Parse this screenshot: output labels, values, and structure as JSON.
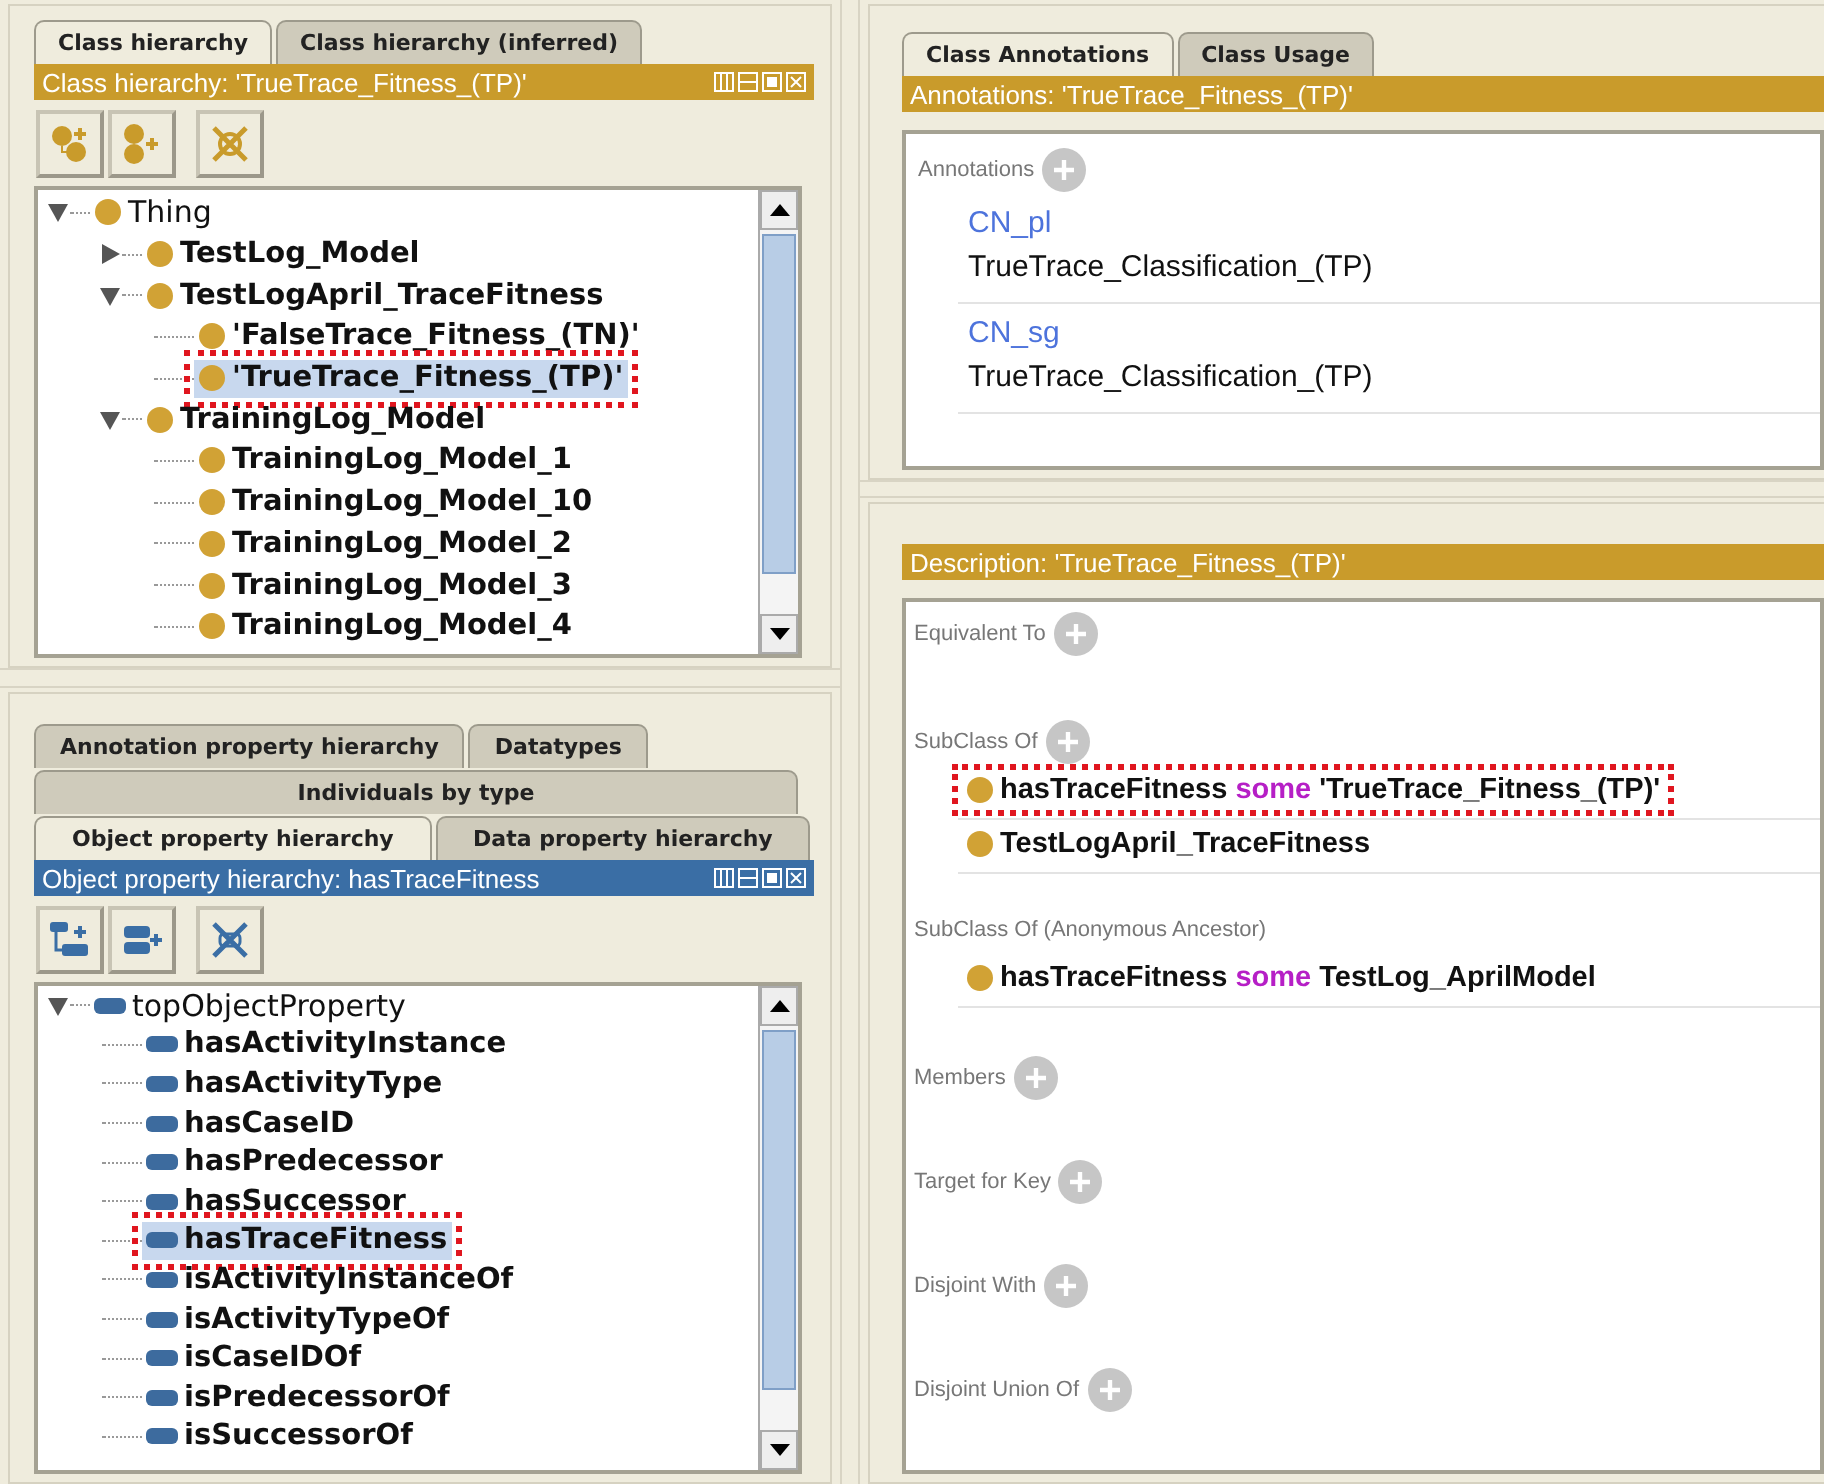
{
  "class_panel": {
    "tabs": [
      {
        "label": "Class hierarchy",
        "selected": true
      },
      {
        "label": "Class hierarchy (inferred)",
        "selected": false
      }
    ],
    "header": {
      "title": "Class hierarchy: 'TrueTrace_Fitness_(TP)'",
      "color": "#c99b2b"
    },
    "tree": {
      "items": [
        {
          "label": "Thing",
          "bold": false,
          "expanded": true,
          "selected": false,
          "highlighted": false,
          "children": [
            {
              "label": "TestLog_Model",
              "bold": true,
              "expanded": false,
              "selected": false,
              "highlighted": false
            },
            {
              "label": "TestLogApril_TraceFitness",
              "bold": true,
              "expanded": true,
              "selected": false,
              "highlighted": false,
              "children": [
                {
                  "label": "'FalseTrace_Fitness_(TN)'",
                  "bold": true,
                  "selected": false,
                  "highlighted": false
                },
                {
                  "label": "'TrueTrace_Fitness_(TP)'",
                  "bold": true,
                  "selected": true,
                  "highlighted": true
                }
              ]
            },
            {
              "label": "TrainingLog_Model",
              "bold": true,
              "expanded": true,
              "selected": false,
              "highlighted": false,
              "children": [
                {
                  "label": "TrainingLog_Model_1",
                  "bold": true,
                  "selected": false,
                  "highlighted": false
                },
                {
                  "label": "TrainingLog_Model_10",
                  "bold": true,
                  "selected": false,
                  "highlighted": false
                },
                {
                  "label": "TrainingLog_Model_2",
                  "bold": true,
                  "selected": false,
                  "highlighted": false
                },
                {
                  "label": "TrainingLog_Model_3",
                  "bold": true,
                  "selected": false,
                  "highlighted": false
                },
                {
                  "label": "TrainingLog_Model_4",
                  "bold": true,
                  "selected": false,
                  "highlighted": false
                }
              ]
            }
          ]
        }
      ]
    }
  },
  "property_panel": {
    "tab_rows": [
      {
        "tabs": [
          {
            "label": "Annotation property hierarchy",
            "selected": false
          },
          {
            "label": "Datatypes",
            "selected": false
          }
        ]
      },
      {
        "tabs": [
          {
            "label": "Individuals by type",
            "selected": false
          }
        ]
      },
      {
        "tabs": [
          {
            "label": "Object property hierarchy",
            "selected": true
          },
          {
            "label": "Data property hierarchy",
            "selected": false
          }
        ]
      }
    ],
    "header": {
      "title": "Object property hierarchy: hasTraceFitness",
      "color": "#3a6ea5"
    },
    "tree": {
      "items": [
        {
          "label": "topObjectProperty",
          "bold": false,
          "expanded": true,
          "selected": false,
          "highlighted": false,
          "children": [
            {
              "label": "hasActivityInstance",
              "bold": true,
              "selected": false,
              "highlighted": false
            },
            {
              "label": "hasActivityType",
              "bold": true,
              "selected": false,
              "highlighted": false
            },
            {
              "label": "hasCaseID",
              "bold": true,
              "selected": false,
              "highlighted": false
            },
            {
              "label": "hasPredecessor",
              "bold": true,
              "selected": false,
              "highlighted": false
            },
            {
              "label": "hasSuccessor",
              "bold": true,
              "selected": false,
              "highlighted": false
            },
            {
              "label": "hasTraceFitness",
              "bold": true,
              "selected": true,
              "highlighted": true
            },
            {
              "label": "isActivityInstanceOf",
              "bold": true,
              "selected": false,
              "highlighted": false
            },
            {
              "label": "isActivityTypeOf",
              "bold": true,
              "selected": false,
              "highlighted": false
            },
            {
              "label": "isCaseIDOf",
              "bold": true,
              "selected": false,
              "highlighted": false
            },
            {
              "label": "isPredecessorOf",
              "bold": true,
              "selected": false,
              "highlighted": false
            },
            {
              "label": "isSuccessorOf",
              "bold": true,
              "selected": false,
              "highlighted": false
            }
          ]
        }
      ]
    }
  },
  "annotation_panel": {
    "tabs": [
      {
        "label": "Class Annotations",
        "selected": true
      },
      {
        "label": "Class Usage",
        "selected": false
      }
    ],
    "header": {
      "title": "Annotations: 'TrueTrace_Fitness_(TP)'",
      "color": "#c99b2b"
    },
    "section": "Annotations",
    "annotations": [
      {
        "property": "CN_pl",
        "value": "TrueTrace_Classification_(TP)"
      },
      {
        "property": "CN_sg",
        "value": "TrueTrace_Classification_(TP)"
      }
    ]
  },
  "description_panel": {
    "header": {
      "title": "Description: 'TrueTrace_Fitness_(TP)'",
      "color": "#c99b2b"
    },
    "sections": [
      {
        "title": "Equivalent To",
        "add_button": true
      },
      {
        "title": "SubClass Of",
        "add_button": true,
        "items": [
          {
            "highlighted": true,
            "parts": [
              {
                "text": "hasTraceFitness",
                "kind": "entity"
              },
              {
                "text": "some",
                "kind": "keyword"
              },
              {
                "text": "'TrueTrace_Fitness_(TP)'",
                "kind": "entity"
              }
            ]
          },
          {
            "highlighted": false,
            "parts": [
              {
                "text": "TestLogApril_TraceFitness",
                "kind": "entity"
              }
            ]
          }
        ]
      },
      {
        "title": "SubClass Of (Anonymous Ancestor)",
        "add_button": false,
        "items": [
          {
            "highlighted": false,
            "parts": [
              {
                "text": "hasTraceFitness",
                "kind": "entity"
              },
              {
                "text": "some",
                "kind": "keyword"
              },
              {
                "text": "TestLog_AprilModel",
                "kind": "entity"
              }
            ]
          }
        ]
      },
      {
        "title": "Members",
        "add_button": true
      },
      {
        "title": "Target for Key",
        "add_button": true
      },
      {
        "title": "Disjoint With",
        "add_button": true
      },
      {
        "title": "Disjoint Union Of",
        "add_button": true
      }
    ]
  }
}
